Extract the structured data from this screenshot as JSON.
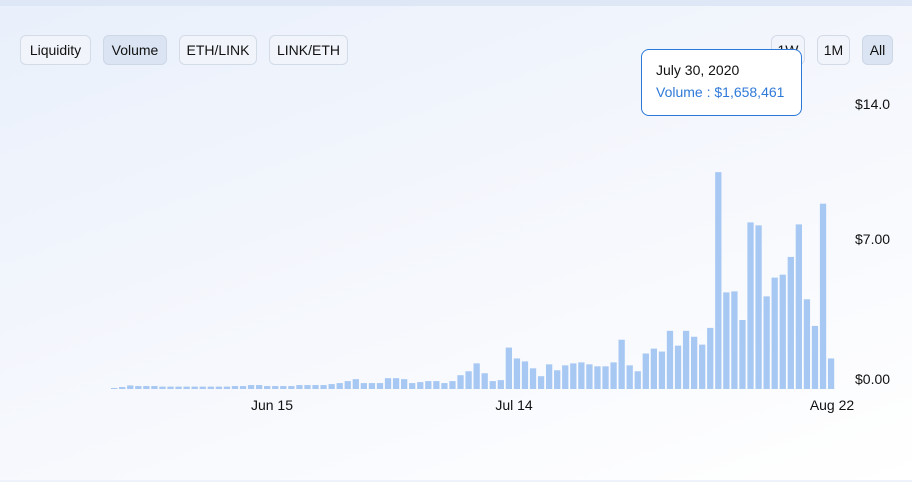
{
  "tabs": {
    "liquidity": "Liquidity",
    "volume": "Volume",
    "eth_link": "ETH/LINK",
    "link_eth": "LINK/ETH"
  },
  "ranges": {
    "w1": "1W",
    "m1": "1M",
    "all": "All"
  },
  "tooltip": {
    "date": "July 30, 2020",
    "label": "Volume : $1,658,461"
  },
  "chart_data": {
    "type": "bar",
    "x_ticks": [
      "Jun 15",
      "Jul 14",
      "Aug 22"
    ],
    "y_ticks": [
      "$14.0",
      "$7.00",
      "$0.00"
    ],
    "ylim": [
      0,
      14
    ],
    "bar_color": "#a7c8f2",
    "values": [
      0.05,
      0.1,
      0.18,
      0.15,
      0.15,
      0.15,
      0.12,
      0.12,
      0.12,
      0.12,
      0.12,
      0.12,
      0.12,
      0.12,
      0.12,
      0.15,
      0.15,
      0.2,
      0.2,
      0.15,
      0.15,
      0.15,
      0.15,
      0.2,
      0.2,
      0.2,
      0.2,
      0.25,
      0.3,
      0.4,
      0.5,
      0.3,
      0.3,
      0.3,
      0.55,
      0.55,
      0.5,
      0.3,
      0.35,
      0.4,
      0.4,
      0.3,
      0.4,
      0.7,
      0.9,
      1.3,
      0.8,
      0.4,
      0.45,
      2.1,
      1.55,
      1.4,
      1.05,
      0.65,
      1.25,
      0.95,
      1.2,
      1.3,
      1.35,
      1.25,
      1.15,
      1.15,
      1.35,
      2.5,
      1.2,
      0.9,
      1.8,
      2.05,
      1.9,
      2.95,
      2.2,
      2.95,
      2.65,
      2.25,
      3.1,
      11.0,
      4.9,
      4.95,
      3.5,
      8.45,
      8.3,
      4.7,
      5.65,
      5.8,
      6.7,
      8.35,
      4.55,
      3.2,
      9.4,
      1.55
    ]
  }
}
